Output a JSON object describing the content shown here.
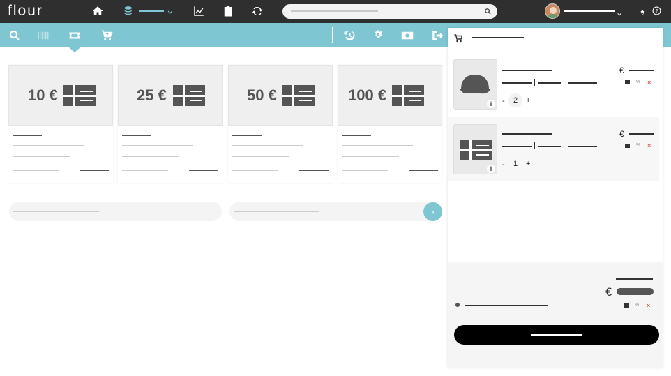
{
  "app": {
    "logo": "flour"
  },
  "topbar": {
    "icons": [
      "home-icon",
      "coins-icon",
      "chevron-down-icon",
      "chart-line-icon",
      "clipboard-icon",
      "sync-icon"
    ],
    "search_icon": "search-icon",
    "right_icons": [
      "gear-icon",
      "help-icon"
    ]
  },
  "subbar": {
    "icons": [
      "search-icon",
      "barcode-icon",
      "ticket-icon",
      "cart-plus-icon",
      "history-icon",
      "gear-icon",
      "cash-icon",
      "sign-out-icon"
    ]
  },
  "products": [
    {
      "price": "10 €"
    },
    {
      "price": "25 €"
    },
    {
      "price": "50 €"
    },
    {
      "price": "100 €"
    }
  ],
  "pagination": {
    "next_label": "›"
  },
  "cart": {
    "icon": "cart-icon",
    "items": [
      {
        "currency": "€",
        "qty": "2",
        "minus": "-",
        "plus": "+",
        "info": "i",
        "pct": "%",
        "x": "×",
        "thumb": "cap-icon"
      },
      {
        "currency": "€",
        "qty": "1",
        "minus": "-",
        "plus": "+",
        "info": "i",
        "pct": "%",
        "x": "×",
        "thumb": "gift-card-icon"
      }
    ],
    "summary": {
      "currency": "€",
      "pct": "%",
      "x": "×"
    }
  },
  "colors": {
    "accent": "#7ec6d1",
    "topbar": "#2f2f2f",
    "checkout": "#000000"
  }
}
